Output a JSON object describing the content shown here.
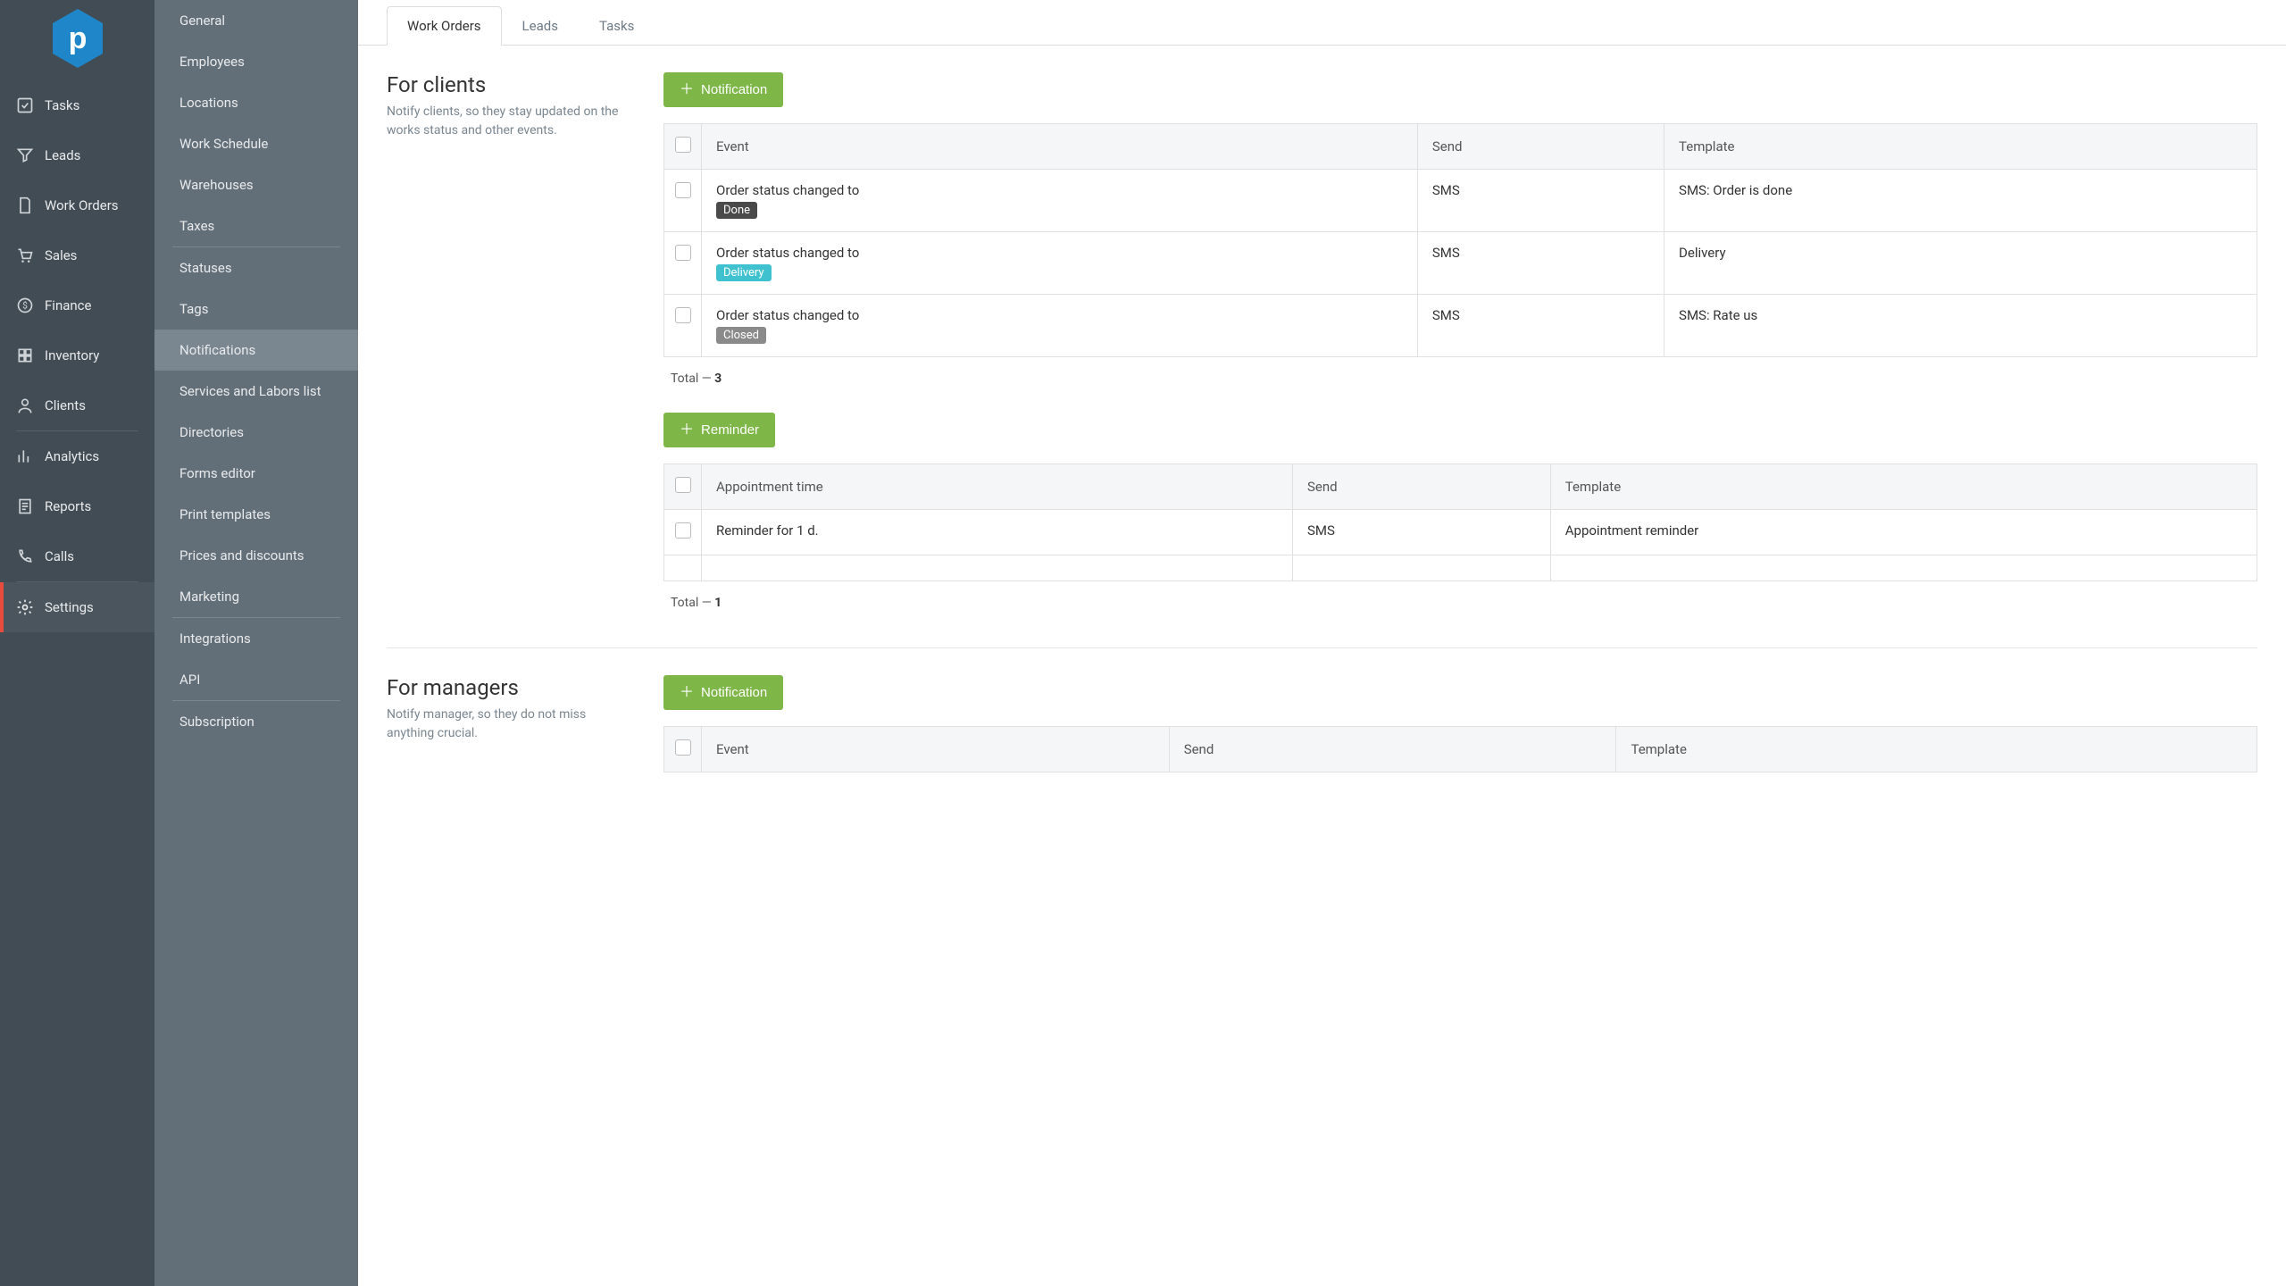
{
  "sidebar": {
    "items": [
      {
        "label": "Tasks"
      },
      {
        "label": "Leads"
      },
      {
        "label": "Work Orders"
      },
      {
        "label": "Sales"
      },
      {
        "label": "Finance"
      },
      {
        "label": "Inventory"
      },
      {
        "label": "Clients"
      },
      {
        "label": "Analytics"
      },
      {
        "label": "Reports"
      },
      {
        "label": "Calls"
      },
      {
        "label": "Settings"
      }
    ]
  },
  "subnav": {
    "items": [
      {
        "label": "General"
      },
      {
        "label": "Employees"
      },
      {
        "label": "Locations"
      },
      {
        "label": "Work Schedule"
      },
      {
        "label": "Warehouses"
      },
      {
        "label": "Taxes"
      },
      {
        "label": "Statuses"
      },
      {
        "label": "Tags"
      },
      {
        "label": "Notifications"
      },
      {
        "label": "Services and Labors list"
      },
      {
        "label": "Directories"
      },
      {
        "label": "Forms editor"
      },
      {
        "label": "Print templates"
      },
      {
        "label": "Prices and discounts"
      },
      {
        "label": "Marketing"
      },
      {
        "label": "Integrations"
      },
      {
        "label": "API"
      },
      {
        "label": "Subscription"
      }
    ]
  },
  "tabs": [
    {
      "label": "Work Orders"
    },
    {
      "label": "Leads"
    },
    {
      "label": "Tasks"
    }
  ],
  "sections": {
    "clients": {
      "title": "For clients",
      "desc": "Notify clients, so they stay updated on the works status and other events."
    },
    "managers": {
      "title": "For managers",
      "desc": "Notify manager, so they do not miss anything crucial."
    }
  },
  "buttons": {
    "notification": "Notification",
    "reminder": "Reminder"
  },
  "table_headers": {
    "event": "Event",
    "send": "Send",
    "template": "Template",
    "appointment_time": "Appointment time"
  },
  "notif_rows": [
    {
      "event_prefix": "Order status changed to",
      "status": "Done",
      "send": "SMS",
      "template": "SMS: Order is done"
    },
    {
      "event_prefix": "Order status changed to",
      "status": "Delivery",
      "send": "SMS",
      "template": "Delivery"
    },
    {
      "event_prefix": "Order status changed to",
      "status": "Closed",
      "send": "SMS",
      "template": "SMS: Rate us"
    }
  ],
  "reminder_rows": [
    {
      "event": "Reminder for 1 d.",
      "send": "SMS",
      "template": "Appointment reminder"
    }
  ],
  "totals": {
    "label": "Total — ",
    "notif": "3",
    "reminder": "1"
  }
}
